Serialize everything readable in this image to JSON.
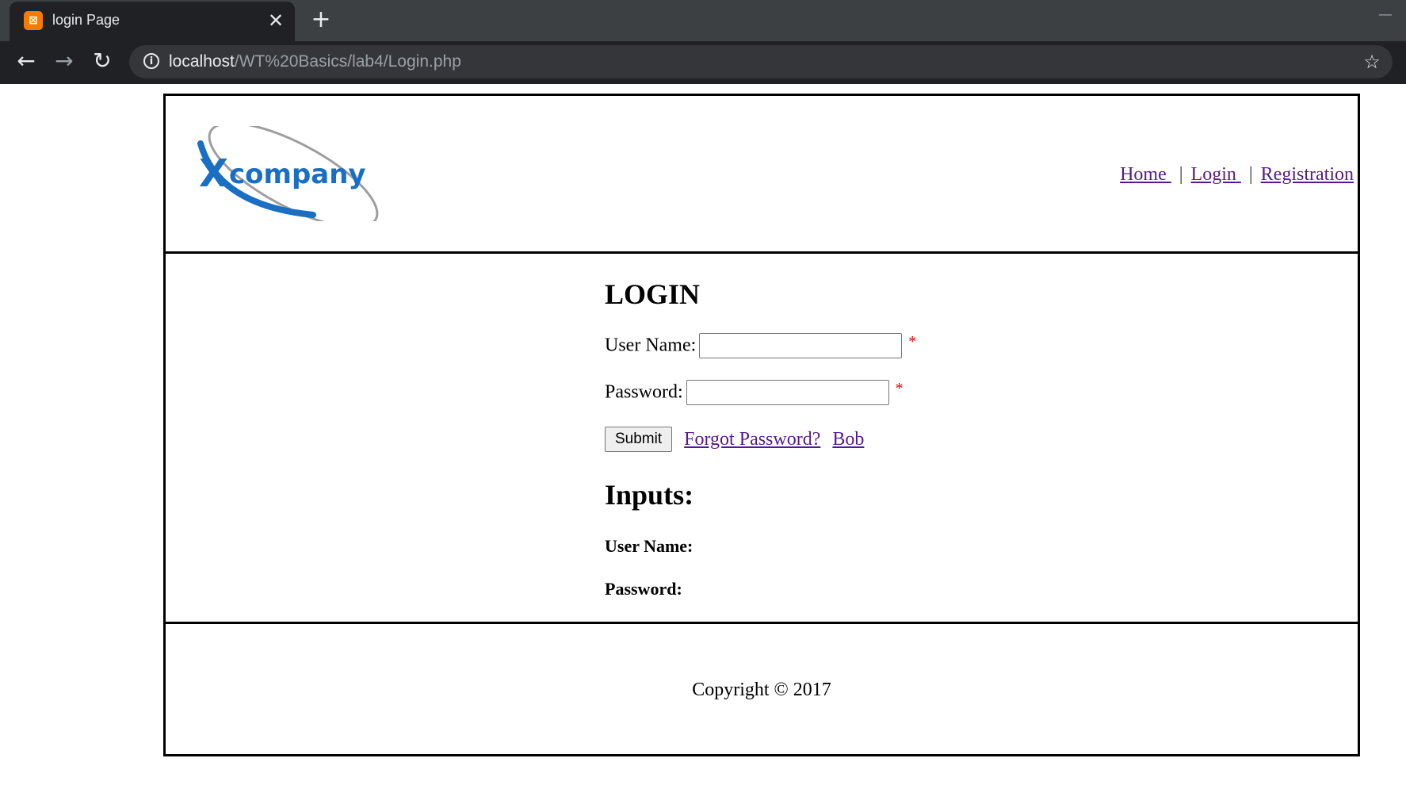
{
  "browser": {
    "tab_title": "login Page",
    "tab_favicon": "xampp-icon",
    "url_host": "localhost",
    "url_path": "/WT%20Basics/lab4/Login.php"
  },
  "header": {
    "logo_text": "Xcompany",
    "nav": {
      "home": "Home ",
      "login": "Login ",
      "registration": "Registration",
      "separator": "|"
    }
  },
  "login_form": {
    "title": "LOGIN",
    "username_label": "User Name:",
    "username_value": "",
    "password_label": "Password:",
    "password_value": "",
    "required_mark": "*",
    "submit_label": "Submit",
    "forgot_link": "Forgot Password?",
    "bob_link": "Bob"
  },
  "inputs_section": {
    "heading": "Inputs:",
    "username_label": "User Name:",
    "password_label": "Password:"
  },
  "footer": {
    "copyright": "Copyright © 2017"
  },
  "colors": {
    "logo_blue": "#1a6fc2",
    "link_visited": "#551a8b",
    "required": "#e00000"
  }
}
